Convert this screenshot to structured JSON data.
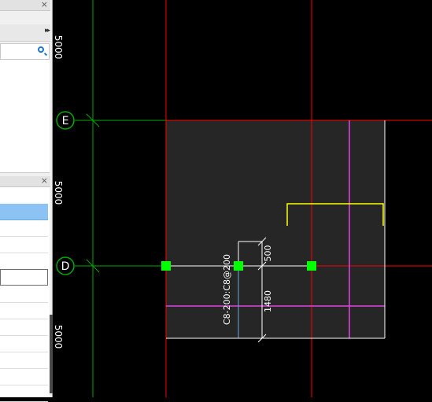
{
  "sidebar": {
    "panel1_close": "×",
    "toolbar_more": "▸▸",
    "panel2_close": "×"
  },
  "canvas": {
    "axis_e": "E",
    "axis_d": "D",
    "dim_span_top": "5000",
    "dim_span_mid": "5000",
    "dim_span_bottom": "5000",
    "rebar_label": "C8-200:C8@200",
    "dim_500": "500",
    "dim_1480": "1480"
  },
  "colors": {
    "slab_fill": "#262626",
    "grid_axis": "#00aa00",
    "column_line": "#ff0000",
    "beam_magenta": "#e040e0",
    "rebar_white": "#ffffff",
    "yellow_mark": "#ffff00",
    "grip": "#00ff00"
  }
}
